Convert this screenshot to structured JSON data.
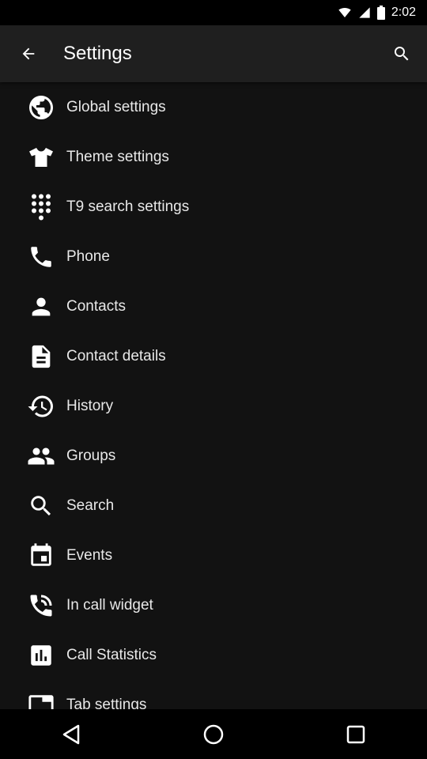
{
  "status_bar": {
    "time": "2:02"
  },
  "app_bar": {
    "title": "Settings",
    "back_icon": "arrow-back-icon",
    "search_icon": "search-icon"
  },
  "items": [
    {
      "label": "Global settings",
      "icon": "globe-icon"
    },
    {
      "label": "Theme settings",
      "icon": "shirt-icon"
    },
    {
      "label": "T9 search settings",
      "icon": "dialpad-icon"
    },
    {
      "label": "Phone",
      "icon": "phone-icon"
    },
    {
      "label": "Contacts",
      "icon": "person-icon"
    },
    {
      "label": "Contact details",
      "icon": "document-icon"
    },
    {
      "label": "History",
      "icon": "history-icon"
    },
    {
      "label": "Groups",
      "icon": "group-icon"
    },
    {
      "label": "Search",
      "icon": "search-icon"
    },
    {
      "label": "Events",
      "icon": "calendar-icon"
    },
    {
      "label": "In call widget",
      "icon": "phone-in-talk-icon"
    },
    {
      "label": "Call Statistics",
      "icon": "bar-chart-icon"
    },
    {
      "label": "Tab settings",
      "icon": "tab-icon"
    }
  ],
  "colors": {
    "background": "#121212",
    "app_bar": "#1f1f1f",
    "text": "#e8e8e8"
  }
}
